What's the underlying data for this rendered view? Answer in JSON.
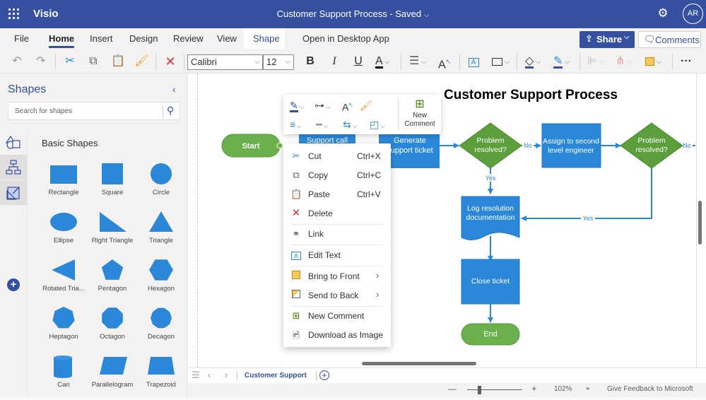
{
  "titlebar": {
    "app_name": "Visio",
    "document_title": "Customer Support Process",
    "save_status": "Saved",
    "separator": " - ",
    "chevron": "⌄",
    "settings_icon": "gear-icon",
    "avatar_initials": "AR"
  },
  "ribbon_tabs": [
    {
      "label": "File",
      "active": false
    },
    {
      "label": "Home",
      "active": true
    },
    {
      "label": "Insert",
      "active": false
    },
    {
      "label": "Design",
      "active": false
    },
    {
      "label": "Review",
      "active": false
    },
    {
      "label": "View",
      "active": false
    },
    {
      "label": "Shape",
      "active": false,
      "contextual": true
    },
    {
      "label": "Open in Desktop App",
      "active": false
    }
  ],
  "share_button": {
    "label": "Share",
    "icon": "share-icon"
  },
  "comments_button": {
    "label": "Comments",
    "icon": "comment-icon"
  },
  "toolbar": {
    "font_name": "Calibri",
    "font_size": "12",
    "bold": "B",
    "italic": "I",
    "underline": "U",
    "font_color_glyph": "A",
    "grow_font_glyph": "A",
    "more": "···",
    "icons": [
      "undo-icon",
      "redo-icon",
      "cut-icon",
      "copy-icon",
      "paste-icon",
      "format-painter-icon",
      "delete-icon",
      "bold-icon",
      "italic-icon",
      "underline-icon",
      "font-color-icon",
      "align-icon",
      "font-size-increase-icon",
      "text-box-icon",
      "shape-style-icon",
      "fill-color-icon",
      "line-color-icon",
      "align-shapes-icon",
      "position-icon",
      "arrange-icon",
      "more-icon"
    ]
  },
  "shapes_pane": {
    "title": "Shapes",
    "search_placeholder": "Search for shapes",
    "category_title": "Basic Shapes",
    "categories": [
      "basic-shapes-icon",
      "flowchart-icon",
      "stencil-icon"
    ],
    "shapes": [
      {
        "label": "Rectangle",
        "kind": "rect"
      },
      {
        "label": "Square",
        "kind": "square"
      },
      {
        "label": "Circle",
        "kind": "circle"
      },
      {
        "label": "Ellipse",
        "kind": "ellipse"
      },
      {
        "label": "Right Triangle",
        "kind": "rtri"
      },
      {
        "label": "Triangle",
        "kind": "tri"
      },
      {
        "label": "Rotated Tria...",
        "kind": "rottri"
      },
      {
        "label": "Pentagon",
        "kind": "pentagon"
      },
      {
        "label": "Hexagon",
        "kind": "hexagon"
      },
      {
        "label": "Heptagon",
        "kind": "heptagon"
      },
      {
        "label": "Octagon",
        "kind": "octagon"
      },
      {
        "label": "Decagon",
        "kind": "decagon"
      },
      {
        "label": "Can",
        "kind": "can"
      },
      {
        "label": "Parallelogram",
        "kind": "para"
      },
      {
        "label": "Trapezoid",
        "kind": "trap"
      }
    ]
  },
  "diagram": {
    "title": "Customer Support Process",
    "nodes": {
      "start": "Start",
      "support_call": "Support call",
      "generate_ticket": [
        "Generate",
        "support ticket"
      ],
      "decision1": [
        "Problem",
        "resolved?"
      ],
      "assign": [
        "Assign to second",
        "level engineer"
      ],
      "decision2": [
        "Problem",
        "resolved?"
      ],
      "log": [
        "Log resolution",
        "documentation"
      ],
      "close": "Close ticket",
      "end": "End"
    },
    "edge_labels": {
      "no1": "No",
      "no2": "No",
      "yes1": "Yes",
      "yes2": "Yes"
    },
    "colors": {
      "process": "#2b88d8",
      "decision": "#5c9e3c",
      "terminator": "#6ab04c",
      "connector": "#2b88d8",
      "title": "#000000"
    }
  },
  "mini_toolbar": {
    "new_comment_label": [
      "New",
      "Comment"
    ],
    "icons": [
      "line-color-icon",
      "connector-style-icon",
      "text-size-icon",
      "format-painter-icon",
      "line-weight-icon",
      "line-dash-icon",
      "arrows-icon",
      "shape-fill-icon",
      "new-comment-icon"
    ]
  },
  "context_menu": {
    "items": [
      {
        "label": "Cut",
        "shortcut": "Ctrl+X",
        "icon": "cut-icon"
      },
      {
        "label": "Copy",
        "shortcut": "Ctrl+C",
        "icon": "copy-icon"
      },
      {
        "label": "Paste",
        "shortcut": "Ctrl+V",
        "icon": "paste-icon"
      },
      {
        "label": "Delete",
        "shortcut": "",
        "icon": "delete-icon"
      },
      {
        "label": "Link",
        "shortcut": "",
        "icon": "link-icon"
      },
      {
        "label": "Edit Text",
        "shortcut": "",
        "icon": "edit-text-icon"
      },
      {
        "label": "Bring to Front",
        "shortcut": "",
        "icon": "bring-front-icon",
        "submenu": true
      },
      {
        "label": "Send to Back",
        "shortcut": "",
        "icon": "send-back-icon",
        "submenu": true
      },
      {
        "label": "New Comment",
        "shortcut": "",
        "icon": "new-comment-icon"
      },
      {
        "label": "Download as Image",
        "shortcut": "",
        "icon": "download-image-icon"
      }
    ]
  },
  "page_bar": {
    "page_name": "Customer Support"
  },
  "status_bar": {
    "zoom_level": "102%",
    "zoom_fraction": 0.3,
    "feedback": "Give Feedback to Microsoft",
    "minus": "—",
    "plus": "+"
  }
}
